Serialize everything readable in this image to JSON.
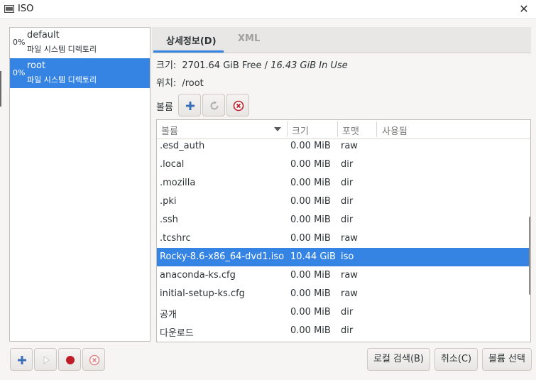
{
  "window": {
    "title": "ISO",
    "close_glyph": "✕"
  },
  "pools": [
    {
      "percent": "0%",
      "name": "default",
      "type": "파일 시스템 디렉토리",
      "selected": false
    },
    {
      "percent": "0%",
      "name": "root",
      "type": "파일 시스템 디렉토리",
      "selected": true
    }
  ],
  "tabs": {
    "details": "상세정보(D)",
    "xml": "XML"
  },
  "details": {
    "size_label": "크기:",
    "size_free": "2701.64 GiB Free",
    "size_sep": " / ",
    "size_in_use": "16.43 GiB In Use",
    "location_label": "위치:",
    "location_value": "/root",
    "volumes_label": "볼륨"
  },
  "toolbar_icons": [
    "add-icon",
    "refresh-icon",
    "delete-icon"
  ],
  "volume_table": {
    "columns": [
      "볼륨",
      "크기",
      "포맷",
      "사용됨"
    ],
    "rows": [
      {
        "name": ".esd_auth",
        "size": "0.00 MiB",
        "format": "raw",
        "used": ""
      },
      {
        "name": ".local",
        "size": "0.00 MiB",
        "format": "dir",
        "used": ""
      },
      {
        "name": ".mozilla",
        "size": "0.00 MiB",
        "format": "dir",
        "used": ""
      },
      {
        "name": ".pki",
        "size": "0.00 MiB",
        "format": "dir",
        "used": ""
      },
      {
        "name": ".ssh",
        "size": "0.00 MiB",
        "format": "dir",
        "used": ""
      },
      {
        "name": ".tcshrc",
        "size": "0.00 MiB",
        "format": "raw",
        "used": ""
      },
      {
        "name": "Rocky-8.6-x86_64-dvd1.iso",
        "size": "10.44 GiB",
        "format": "iso",
        "used": "",
        "selected": true
      },
      {
        "name": "anaconda-ks.cfg",
        "size": "0.00 MiB",
        "format": "raw",
        "used": ""
      },
      {
        "name": "initial-setup-ks.cfg",
        "size": "0.00 MiB",
        "format": "raw",
        "used": ""
      },
      {
        "name": "공개",
        "size": "0.00 MiB",
        "format": "dir",
        "used": ""
      },
      {
        "name": "다운로드",
        "size": "0.00 MiB",
        "format": "dir",
        "used": ""
      }
    ]
  },
  "bottom_buttons": {
    "browse_local": "로컬 검색(B)",
    "cancel": "취소(C)",
    "choose_volume": "볼륨 선택"
  },
  "colors": {
    "accent": "#3584e4",
    "stop_red": "#c01c28"
  }
}
